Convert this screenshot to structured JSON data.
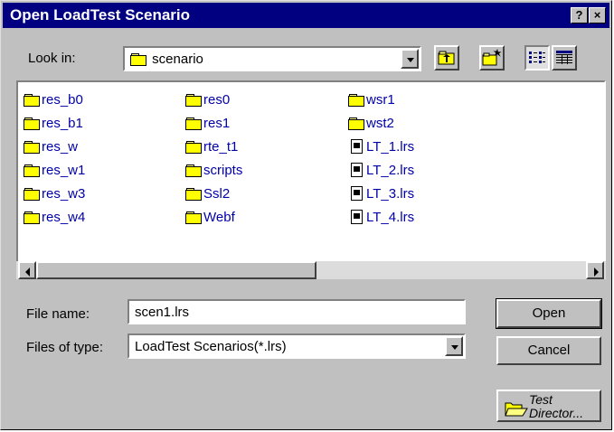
{
  "window": {
    "title": "Open LoadTest Scenario",
    "help_label": "?",
    "close_label": "×"
  },
  "lookin": {
    "label": "Look in:",
    "value": "scenario"
  },
  "toolbar": {
    "up_icon": "up-folder-icon",
    "new_folder_icon": "new-folder-icon",
    "list_icon": "list-view-icon",
    "details_icon": "details-view-icon"
  },
  "files": {
    "col1": [
      "res_b0",
      "res_b1",
      "res_w",
      "res_w1",
      "res_w3",
      "res_w4"
    ],
    "col2": [
      "res0",
      "res1",
      "rte_t1",
      "scripts",
      "Ssl2",
      "Webf"
    ],
    "col3_folders": [
      "wsr1",
      "wst2"
    ],
    "col3_files": [
      "LT_1.lrs",
      "LT_2.lrs",
      "LT_3.lrs",
      "LT_4.lrs"
    ]
  },
  "filename": {
    "label": "File name:",
    "value": "scen1.lrs"
  },
  "filetype": {
    "label": "Files of type:",
    "value": "LoadTest Scenarios(*.lrs)"
  },
  "buttons": {
    "open": "Open",
    "cancel": "Cancel",
    "td_line1": "Test",
    "td_line2": "Director..."
  }
}
